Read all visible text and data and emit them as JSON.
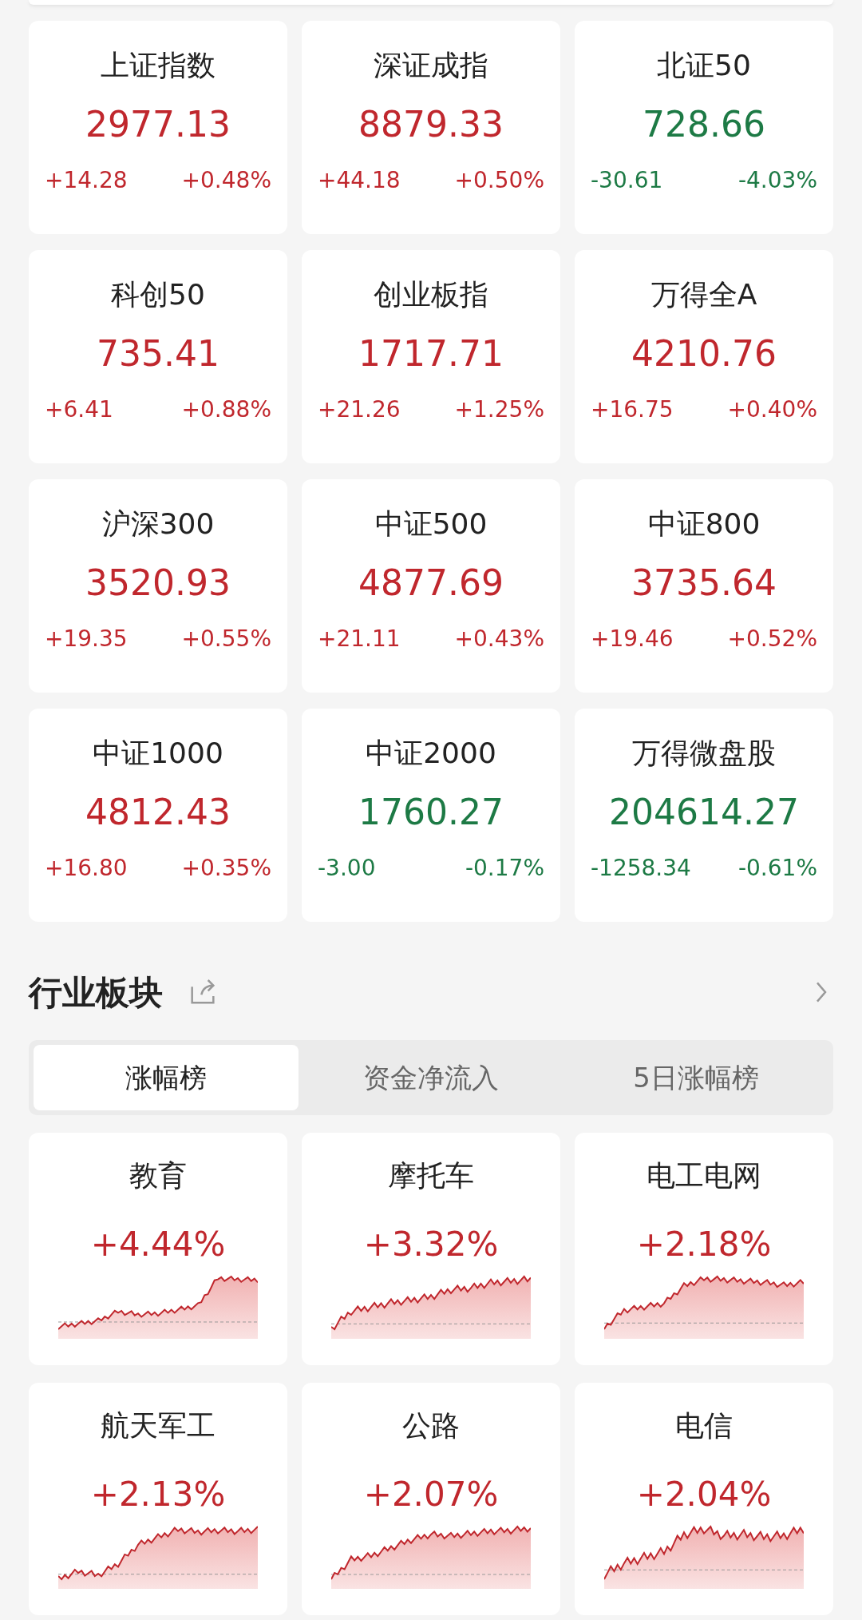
{
  "indices": [
    {
      "name": "上证指数",
      "value": "2977.13",
      "change": "+14.28",
      "percent": "+0.48%",
      "rising": true
    },
    {
      "name": "深证成指",
      "value": "8879.33",
      "change": "+44.18",
      "percent": "+0.50%",
      "rising": true
    },
    {
      "name": "北证50",
      "value": "728.66",
      "change": "-30.61",
      "percent": "-4.03%",
      "rising": false
    },
    {
      "name": "科创50",
      "value": "735.41",
      "change": "+6.41",
      "percent": "+0.88%",
      "rising": true
    },
    {
      "name": "创业板指",
      "value": "1717.71",
      "change": "+21.26",
      "percent": "+1.25%",
      "rising": true
    },
    {
      "name": "万得全A",
      "value": "4210.76",
      "change": "+16.75",
      "percent": "+0.40%",
      "rising": true
    },
    {
      "name": "沪深300",
      "value": "3520.93",
      "change": "+19.35",
      "percent": "+0.55%",
      "rising": true
    },
    {
      "name": "中证500",
      "value": "4877.69",
      "change": "+21.11",
      "percent": "+0.43%",
      "rising": true
    },
    {
      "name": "中证800",
      "value": "3735.64",
      "change": "+19.46",
      "percent": "+0.52%",
      "rising": true
    },
    {
      "name": "中证1000",
      "value": "4812.43",
      "change": "+16.80",
      "percent": "+0.35%",
      "rising": true
    },
    {
      "name": "中证2000",
      "value": "1760.27",
      "change": "-3.00",
      "percent": "-0.17%",
      "rising": false
    },
    {
      "name": "万得微盘股",
      "value": "204614.27",
      "change": "-1258.34",
      "percent": "-0.61%",
      "rising": false
    }
  ],
  "sector_section": {
    "title": "行业板块",
    "tabs": [
      {
        "label": "涨幅榜",
        "selected": true
      },
      {
        "label": "资金净流入",
        "selected": false
      },
      {
        "label": "5日涨幅榜",
        "selected": false
      }
    ],
    "sectors": [
      {
        "name": "教育",
        "percent": "+4.44%",
        "rising": true
      },
      {
        "name": "摩托车",
        "percent": "+3.32%",
        "rising": true
      },
      {
        "name": "电工电网",
        "percent": "+2.18%",
        "rising": true
      },
      {
        "name": "航天军工",
        "percent": "+2.13%",
        "rising": true
      },
      {
        "name": "公路",
        "percent": "+2.07%",
        "rising": true
      },
      {
        "name": "电信",
        "percent": "+2.04%",
        "rising": true
      }
    ]
  }
}
